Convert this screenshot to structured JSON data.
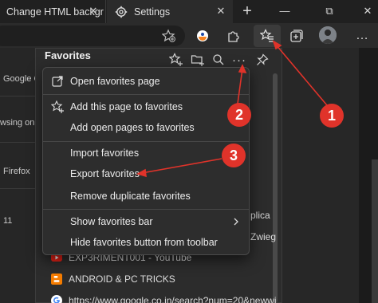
{
  "tabs": [
    {
      "title": "Change HTML backgr",
      "close_glyph": "✕"
    },
    {
      "title": "Settings",
      "close_glyph": "✕"
    }
  ],
  "new_tab_glyph": "+",
  "window_controls": {
    "minimize": "—",
    "maximize": "⧉",
    "close": "✕"
  },
  "toolbar": {
    "icons": [
      "add-favorite-star-icon",
      "sidebar-search-icon",
      "extensions-icon",
      "favorites-icon",
      "collections-icon",
      "profile-avatar",
      "more-icon"
    ],
    "more_glyph": "…"
  },
  "background": {
    "left_texts": [
      "Google C",
      "wsing on",
      "Firefox",
      "11"
    ],
    "right_texts": [
      "plica",
      "Zwieg"
    ]
  },
  "favorites": {
    "title": "Favorites",
    "more_glyph": "···",
    "items": [
      {
        "label": "plica",
        "icon_color": "#c0c0c0"
      },
      {
        "label": "Zwieg",
        "icon_color": "#c0c0c0"
      },
      {
        "label": "EXP3RIMENT001 - YouTube",
        "icon_color": "#e62117"
      },
      {
        "label": "ANDROID & PC TRICKS",
        "icon_color": "#f57c00"
      },
      {
        "label": "https://www.google.co.in/search?num=20&newwi",
        "icon_color": "#ffffff"
      }
    ]
  },
  "menu": {
    "items": [
      {
        "label": "Open favorites page",
        "icon": "open-external-icon"
      },
      {
        "label": "Add this page to favorites",
        "icon": "star-add-icon"
      },
      {
        "label": "Add open pages to favorites",
        "icon": ""
      },
      {
        "label": "Import favorites",
        "icon": ""
      },
      {
        "label": "Export favorites",
        "icon": ""
      },
      {
        "label": "Remove duplicate favorites",
        "icon": ""
      },
      {
        "label": "Show favorites bar",
        "icon": "",
        "has_submenu": true
      },
      {
        "label": "Hide favorites button from toolbar",
        "icon": ""
      }
    ]
  },
  "annotations": {
    "badges": [
      "1",
      "2",
      "3"
    ],
    "color": "#e0332a"
  }
}
